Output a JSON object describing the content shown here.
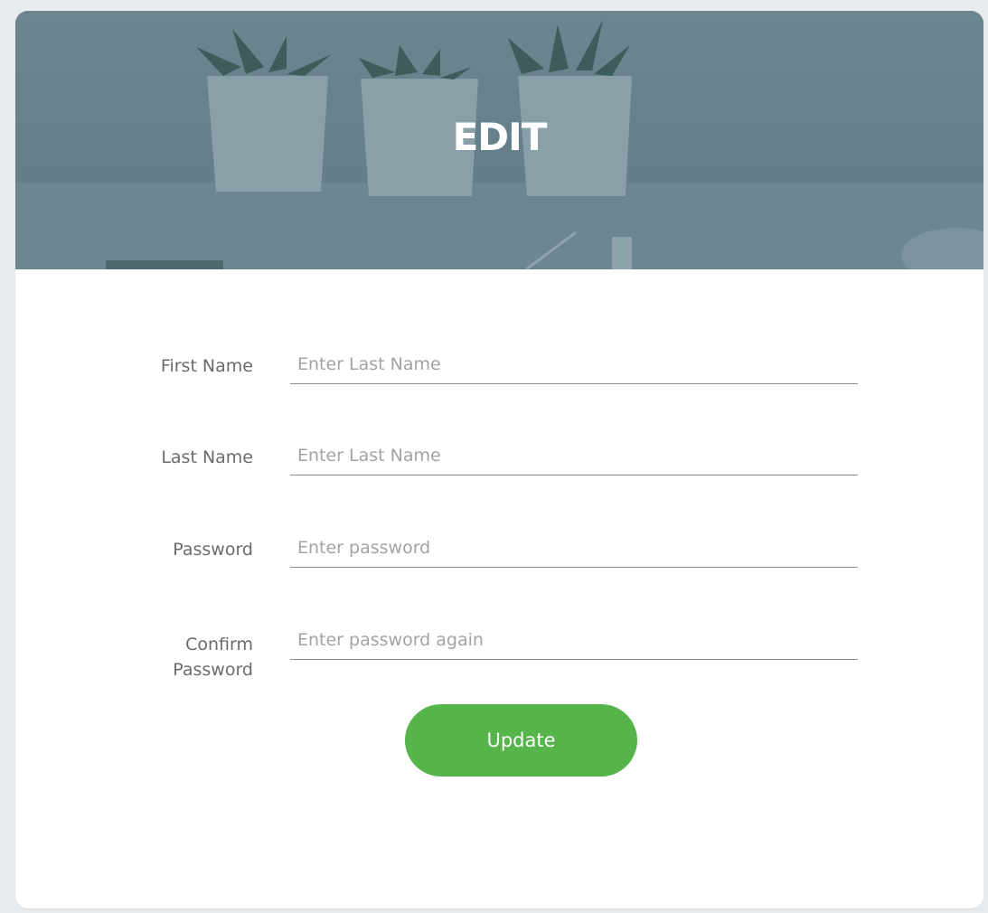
{
  "header": {
    "title": "EDIT"
  },
  "form": {
    "fields": [
      {
        "label": "First Name",
        "placeholder": "Enter Last Name",
        "value": ""
      },
      {
        "label": "Last Name",
        "placeholder": "Enter Last Name",
        "value": ""
      },
      {
        "label": "Password",
        "placeholder": "Enter password",
        "value": ""
      },
      {
        "label_line1": "Confirm",
        "label_line2": "Password",
        "placeholder": "Enter password again",
        "value": ""
      }
    ],
    "submit_label": "Update"
  },
  "colors": {
    "header_overlay": "#5f7983",
    "button": "#55b44a",
    "page_background": "#e9ecef"
  }
}
